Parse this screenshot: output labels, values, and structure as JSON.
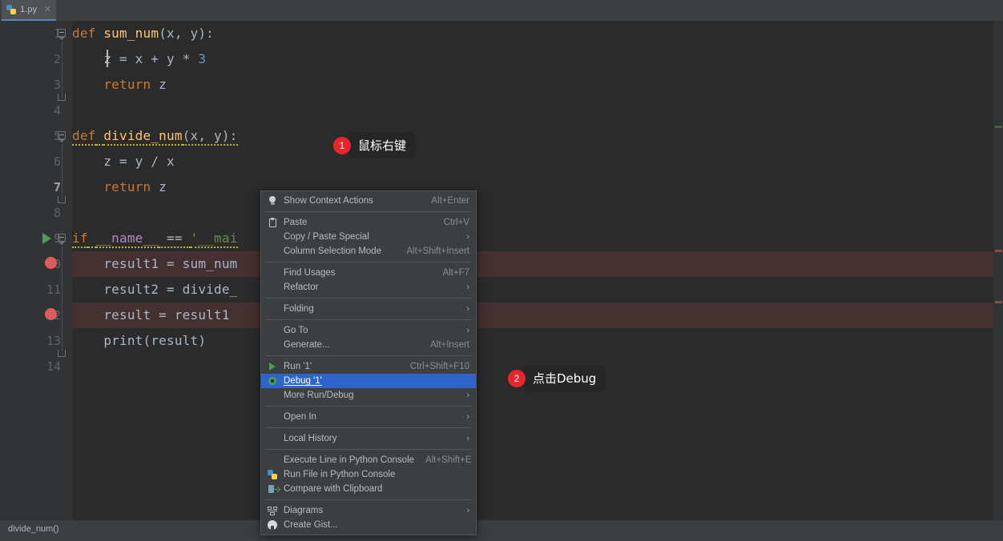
{
  "window": {
    "tab": {
      "filename": "1.py",
      "icon": "python-file-icon",
      "close_icon": "close-icon"
    }
  },
  "editor": {
    "line_numbers": [
      "1",
      "2",
      "3",
      "4",
      "5",
      "6",
      "7",
      "8",
      "9",
      "10",
      "11",
      "12",
      "13",
      "14"
    ],
    "current_line": "7",
    "breakpoint_lines": [
      "10",
      "12"
    ],
    "run_marker_line": "9",
    "code": [
      {
        "n": "1",
        "text": "def sum_num(x, y):"
      },
      {
        "n": "2",
        "text": "    z = x + y * 3"
      },
      {
        "n": "3",
        "text": "    return z"
      },
      {
        "n": "4",
        "text": ""
      },
      {
        "n": "5",
        "text": "def divide_num(x, y):"
      },
      {
        "n": "6",
        "text": "    z = y / x"
      },
      {
        "n": "7",
        "text": "    return z"
      },
      {
        "n": "8",
        "text": ""
      },
      {
        "n": "9",
        "text": "if __name__ == '__mai"
      },
      {
        "n": "10",
        "text": "    result1 = sum_num"
      },
      {
        "n": "11",
        "text": "    result2 = divide_"
      },
      {
        "n": "12",
        "text": "    result = result1"
      },
      {
        "n": "13",
        "text": "    print(result)"
      },
      {
        "n": "14",
        "text": ""
      }
    ]
  },
  "context_menu": {
    "items": [
      {
        "label": "Show Context Actions",
        "accel": "Alt+Enter",
        "icon": "lightbulb-icon"
      },
      {
        "sep": true
      },
      {
        "label": "Paste",
        "accel": "Ctrl+V",
        "icon": "clipboard-icon"
      },
      {
        "label": "Copy / Paste Special",
        "arrow": "›"
      },
      {
        "label": "Column Selection Mode",
        "accel": "Alt+Shift+Insert"
      },
      {
        "sep": true
      },
      {
        "label": "Find Usages",
        "accel": "Alt+F7"
      },
      {
        "label": "Refactor",
        "arrow": "›"
      },
      {
        "sep": true
      },
      {
        "label": "Folding",
        "arrow": "›"
      },
      {
        "sep": true
      },
      {
        "label": "Go To",
        "arrow": "›"
      },
      {
        "label": "Generate...",
        "accel": "Alt+Insert"
      },
      {
        "sep": true
      },
      {
        "label": "Run '1'",
        "accel": "Ctrl+Shift+F10",
        "icon": "run-icon"
      },
      {
        "label": "Debug '1'",
        "icon": "debug-icon",
        "selected": true
      },
      {
        "label": "More Run/Debug",
        "arrow": "›"
      },
      {
        "sep": true
      },
      {
        "label": "Open In",
        "arrow": "›"
      },
      {
        "sep": true
      },
      {
        "label": "Local History",
        "arrow": "›"
      },
      {
        "sep": true
      },
      {
        "label": "Execute Line in Python Console",
        "accel": "Alt+Shift+E"
      },
      {
        "label": "Run File in Python Console",
        "icon": "python-console-icon"
      },
      {
        "label": "Compare with Clipboard",
        "icon": "compare-icon"
      },
      {
        "sep": true
      },
      {
        "label": "Diagrams",
        "arrow": "›",
        "icon": "diagram-icon"
      },
      {
        "label": "Create Gist...",
        "icon": "github-gist-icon"
      }
    ],
    "selected_label": "Debug '1'"
  },
  "annotations": [
    {
      "number": "1",
      "text": "鼠标右键"
    },
    {
      "number": "2",
      "text": "点击Debug"
    }
  ],
  "status_bar": {
    "breadcrumb": "divide_num()"
  },
  "colors": {
    "editor_bg": "#2b2b2b",
    "gutter_bg": "#313335",
    "chrome_bg": "#3c3f41",
    "keyword": "#cc7832",
    "function": "#ffc66d",
    "number": "#6897bb",
    "string": "#6a8759",
    "dunder": "#b389c5",
    "default_text": "#a9b7c6",
    "menu_highlight": "#2f65ca",
    "breakpoint_red": "#db5c5c",
    "run_green": "#499c54",
    "annotation_red": "#e8252a",
    "warning_underline": "#bbb529"
  }
}
